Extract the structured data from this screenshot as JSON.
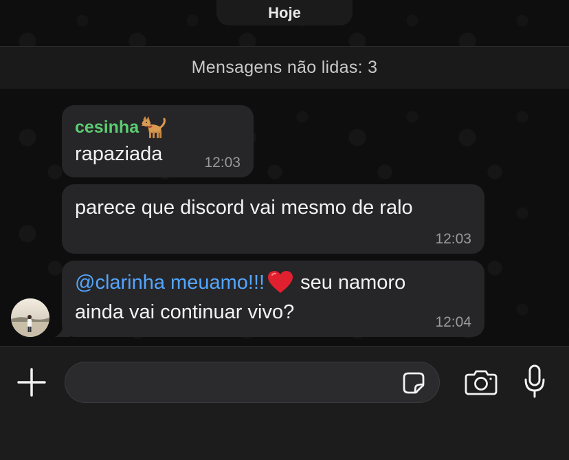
{
  "date_separator": "Hoje",
  "unread_banner": "Mensagens não lidas: 3",
  "messages": [
    {
      "sender": "cesinha",
      "sender_emoji": "dog-emoji",
      "text": "rapaziada",
      "time": "12:03"
    },
    {
      "text": "parece que discord vai mesmo de ralo",
      "time": "12:03"
    },
    {
      "mention": "@clarinha meuamo!!!",
      "mention_emoji": "red-heart-emoji",
      "text_line1": "seu namoro",
      "text_line2": "ainda vai continuar vivo?",
      "time": "12:04"
    }
  ],
  "composer": {
    "input_value": "",
    "icons": [
      "plus-icon",
      "sticker-icon",
      "camera-icon",
      "microphone-icon"
    ]
  },
  "colors": {
    "sender_name": "#5ccd71",
    "mention": "#53a6ff",
    "bubble": "#262628",
    "background": "#0e0e0e"
  }
}
